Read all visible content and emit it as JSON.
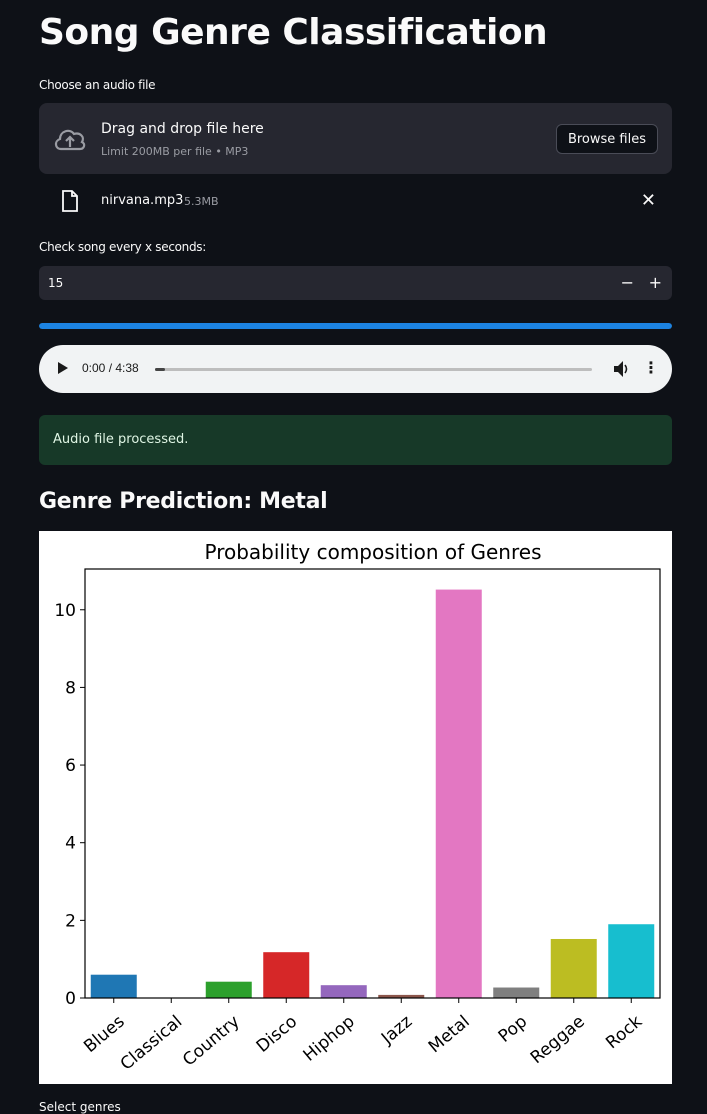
{
  "page": {
    "title": "Song Genre Classification",
    "uploader_label": "Choose an audio file",
    "dropzone": {
      "primary_text": "Drag and drop file here",
      "secondary_text": "Limit 200MB per file • MP3",
      "browse_label": "Browse files",
      "icon": "cloud-upload-icon"
    },
    "uploaded_file": {
      "name": "nirvana.mp3",
      "size": "5.3MB",
      "icon": "file-icon",
      "remove_icon": "close-icon",
      "remove_glyph": "✕"
    },
    "interval_label": "Check song every x seconds:",
    "interval_value": "15",
    "stepper": {
      "minus": "−",
      "plus": "+"
    },
    "progress": {
      "fraction": 1.0,
      "color": "#1c83e1"
    },
    "audio_player": {
      "time": "0:00 / 4:38",
      "playback_fraction": 0.0
    },
    "alert": {
      "text": "Audio file processed.",
      "color": "#173928"
    },
    "prediction_heading": "Genre Prediction: Metal",
    "next_label": "Select genres",
    "menu_glyph": "⋮"
  },
  "chart_data": {
    "type": "bar",
    "title": "Probability composition of Genres",
    "categories": [
      "Blues",
      "Classical",
      "Country",
      "Disco",
      "Hiphop",
      "Jazz",
      "Metal",
      "Pop",
      "Reggae",
      "Rock"
    ],
    "values": [
      0.6,
      0.0,
      0.42,
      1.18,
      0.33,
      0.08,
      10.52,
      0.27,
      1.52,
      1.9
    ],
    "colors": [
      "#1f77b4",
      "#ff7f0e",
      "#2ca02c",
      "#d62728",
      "#9467bd",
      "#8c564b",
      "#e377c2",
      "#7f7f7f",
      "#bcbd22",
      "#17becf"
    ],
    "yticks": [
      0,
      2,
      4,
      6,
      8,
      10
    ],
    "ylim": [
      0,
      11.05
    ],
    "xlabel": "",
    "ylabel": "",
    "grid": false
  }
}
